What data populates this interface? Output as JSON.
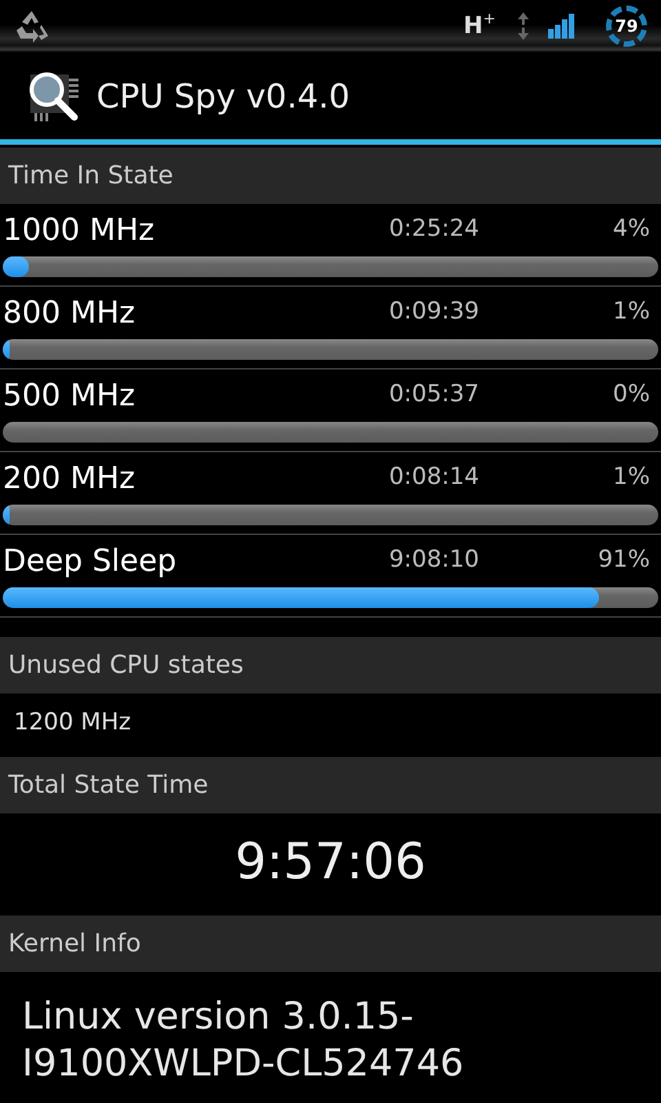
{
  "status_bar": {
    "network": "H$^{+}$",
    "battery": "79"
  },
  "app_bar": {
    "title": "CPU Spy v0.4.0"
  },
  "time_in_state": {
    "header": "Time In State",
    "states": [
      {
        "name": "1000 MHz",
        "time": "0:25:24",
        "percent": "4%",
        "level": 0.04
      },
      {
        "name": "800 MHz",
        "time": "0:09:39",
        "percent": "1%",
        "level": 0.01
      },
      {
        "name": "500 MHz",
        "time": "0:05:37",
        "percent": "0%"
      },
      {
        "name": "200 MHz",
        "time": "0:08:14",
        "percent": "1%",
        "level": 0.01
      },
      {
        "name": "Deep Sleep",
        "time": "9:08:10",
        "percent": "91%",
        "level": 0.91
      }
    ]
  },
  "unused_cpu_states": {
    "header": "Unused CPU states",
    "value": "1200 MHz"
  },
  "total_state_time": {
    "header": "Total State Time",
    "value": "9:57:06"
  },
  "kernel_info": {
    "header": "Kernel Info",
    "lines": [
      "Linux version 3.0.15-",
      "I9100XWLPD-CL524746"
    ]
  }
}
